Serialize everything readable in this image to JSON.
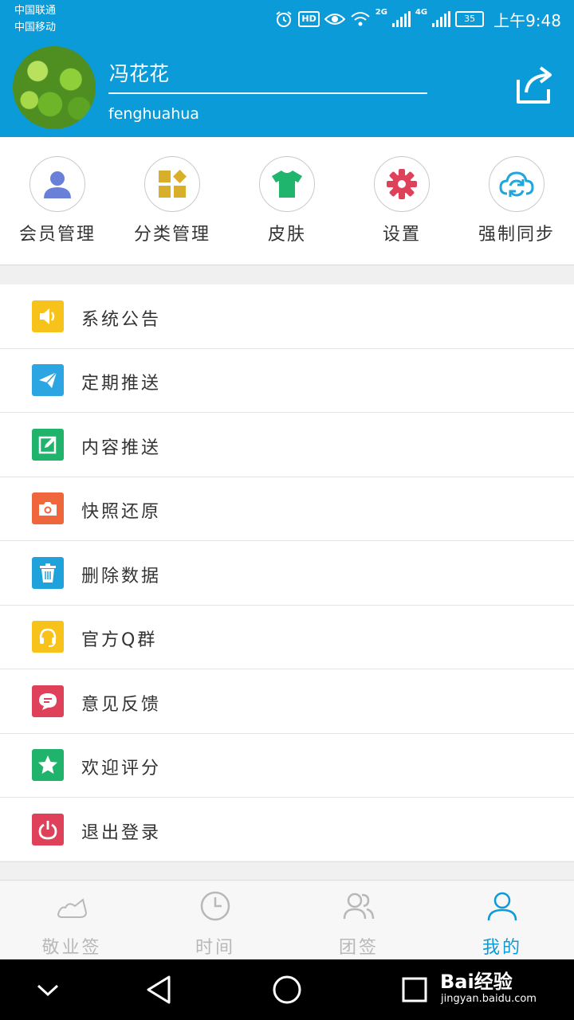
{
  "status_bar": {
    "carrier1": "中国联通",
    "carrier2": "中国移动",
    "hd": "HD",
    "net1": "2G",
    "net2": "4G",
    "battery": "35",
    "time": "上午9:48"
  },
  "profile": {
    "name": "冯花花",
    "username": "fenghuahua"
  },
  "quick_actions": [
    {
      "label": "会员管理",
      "icon": "user-icon",
      "color": "#6a7fd8"
    },
    {
      "label": "分类管理",
      "icon": "category-icon",
      "color": "#d8ae2a"
    },
    {
      "label": "皮肤",
      "icon": "tshirt-icon",
      "color": "#1fb56c"
    },
    {
      "label": "设置",
      "icon": "gear-icon",
      "color": "#e0415a"
    },
    {
      "label": "强制同步",
      "icon": "cloud-sync-icon",
      "color": "#1fa6dd"
    }
  ],
  "menu": [
    {
      "label": "系统公告",
      "icon": "speaker-icon",
      "color": "#f7c21a"
    },
    {
      "label": "定期推送",
      "icon": "paper-plane-icon",
      "color": "#2ba6e2"
    },
    {
      "label": "内容推送",
      "icon": "edit-icon",
      "color": "#1fb36b"
    },
    {
      "label": "快照还原",
      "icon": "camera-icon",
      "color": "#f0663c"
    },
    {
      "label": "删除数据",
      "icon": "trash-icon",
      "color": "#1fa2dc"
    },
    {
      "label": "官方Q群",
      "icon": "headset-icon",
      "color": "#f7c21a"
    },
    {
      "label": "意见反馈",
      "icon": "chat-icon",
      "color": "#e0415a"
    },
    {
      "label": "欢迎评分",
      "icon": "star-icon",
      "color": "#1fb36b"
    },
    {
      "label": "退出登录",
      "icon": "power-icon",
      "color": "#e0415a"
    }
  ],
  "tabs": [
    {
      "label": "敬业签",
      "icon": "note-icon",
      "active": false
    },
    {
      "label": "时间",
      "icon": "clock-icon",
      "active": false
    },
    {
      "label": "团签",
      "icon": "group-icon",
      "active": false
    },
    {
      "label": "我的",
      "icon": "person-icon",
      "active": true
    }
  ],
  "watermark": {
    "brand": "Bai经验",
    "url": "jingyan.baidu.com"
  },
  "colors": {
    "primary": "#0a9bd8",
    "tab_inactive": "#b8b8b8"
  }
}
